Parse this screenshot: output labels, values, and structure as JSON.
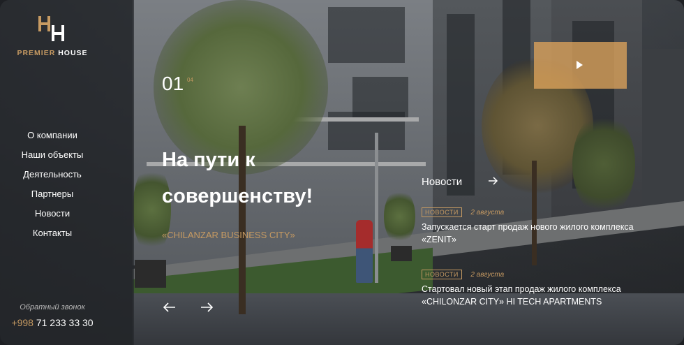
{
  "brand": {
    "name_part1": "PREMIER",
    "name_part2": "HOUSE",
    "accent_color": "#c69a62"
  },
  "nav": {
    "items": [
      {
        "label": "О компании"
      },
      {
        "label": "Наши объекты"
      },
      {
        "label": "Деятельность"
      },
      {
        "label": "Партнеры"
      },
      {
        "label": "Новости"
      },
      {
        "label": "Контакты"
      }
    ]
  },
  "contact": {
    "callback_label": "Обратный звонок",
    "phone_prefix": "+998",
    "phone_number": "71 233 33 30"
  },
  "slider": {
    "current": "01",
    "total": "04",
    "title": "На пути к совершенству!",
    "subtitle": "«CHILANZAR BUSINESS CITY»",
    "prev_icon": "arrow-left-icon",
    "next_icon": "arrow-right-icon"
  },
  "video": {
    "icon": "play-icon"
  },
  "news": {
    "heading": "Новости",
    "arrow_icon": "arrow-right-icon",
    "items": [
      {
        "badge": "НОВОСТИ",
        "date": "2 августа",
        "title": "Запускается старт продаж нового жилого комплекса «ZENIT»"
      },
      {
        "badge": "НОВОСТИ",
        "date": "2 августа",
        "title": "Стартовал новый этап продаж жилого комплекса «CHILONZAR CITY» HI TECH APARTMENTS"
      }
    ]
  }
}
